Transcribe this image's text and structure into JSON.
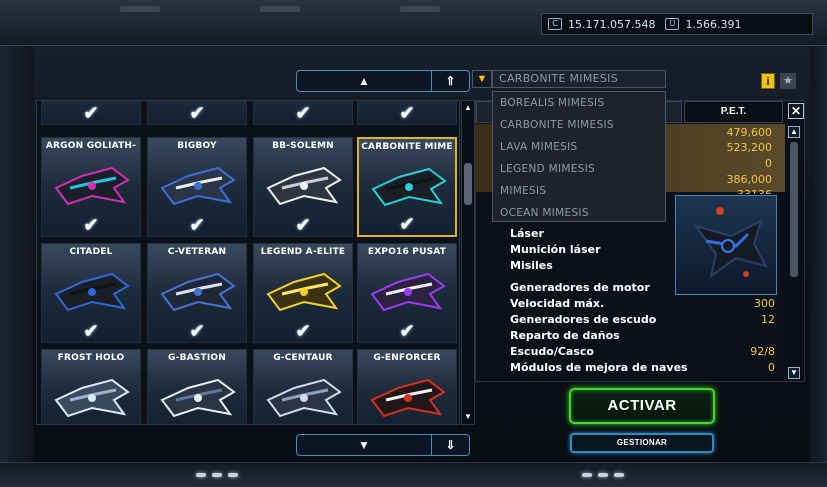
{
  "header": {
    "credits": "15.171.057.548",
    "uridium": "1.566.391",
    "credits_icon": "credits-icon",
    "uridium_icon": "uridium-icon"
  },
  "ship_grid": {
    "rows": [
      [
        {
          "name": "",
          "checked": true
        },
        {
          "name": "",
          "checked": true
        },
        {
          "name": "",
          "checked": true
        },
        {
          "name": "",
          "checked": true
        }
      ],
      [
        {
          "name": "ARGON GOLIATH-",
          "checked": true,
          "selected": false
        },
        {
          "name": "BIGBOY",
          "checked": true,
          "selected": false
        },
        {
          "name": "BB-SOLEMN",
          "checked": true,
          "selected": false
        },
        {
          "name": "CARBONITE MIME",
          "checked": true,
          "selected": true
        }
      ],
      [
        {
          "name": "CITADEL",
          "checked": true,
          "selected": false
        },
        {
          "name": "C-VETERAN",
          "checked": true,
          "selected": false
        },
        {
          "name": "LEGEND A-ELITE",
          "checked": true,
          "selected": false
        },
        {
          "name": "EXPO16 PUSAT",
          "checked": true,
          "selected": false
        }
      ],
      [
        {
          "name": "FROST HOLO",
          "checked": false,
          "selected": false
        },
        {
          "name": "G-BASTION",
          "checked": false,
          "selected": false
        },
        {
          "name": "G-CENTAUR",
          "checked": false,
          "selected": false
        },
        {
          "name": "G-ENFORCER",
          "checked": false,
          "selected": false
        }
      ]
    ],
    "nav_up": "▲",
    "nav_up_fast": "⇑",
    "nav_down": "▼",
    "nav_down_fast": "⇓"
  },
  "design_dropdown": {
    "selected": "CARBONITE MIMESIS",
    "options": [
      "BOREALIS MIMESIS",
      "CARBONITE MIMESIS",
      "LAVA MIMESIS",
      "LEGEND MIMESIS",
      "MIMESIS",
      "OCEAN MIMESIS"
    ]
  },
  "stats": {
    "tab_pet": "P.E.T.",
    "close": "✕",
    "top_values": [
      "479,600",
      "523,200",
      "0",
      "386,000",
      "33136"
    ],
    "rows": [
      {
        "label": "Láser",
        "value": ""
      },
      {
        "label": "Munición láser",
        "value": ""
      },
      {
        "label": "Misiles",
        "value": ""
      },
      {
        "label": "Generadores de motor",
        "value": ""
      },
      {
        "label": "Velocidad máx.",
        "value": "300"
      },
      {
        "label": "Generadores de escudo",
        "value": "12"
      },
      {
        "label": "Reparto de daños",
        "value": ""
      },
      {
        "label": "Escudo/Casco",
        "value": "92/8"
      },
      {
        "label": "Módulos de mejora de naves",
        "value": "0"
      }
    ]
  },
  "buttons": {
    "activate": "ACTIVAR",
    "manage": "GESTIONAR",
    "info": "i",
    "favorite": "★"
  },
  "colors": {
    "accent_gold": "#f2c641",
    "accent_green": "#48d52a",
    "accent_blue": "#2e8bc6",
    "selected_border": "#e1b427"
  }
}
